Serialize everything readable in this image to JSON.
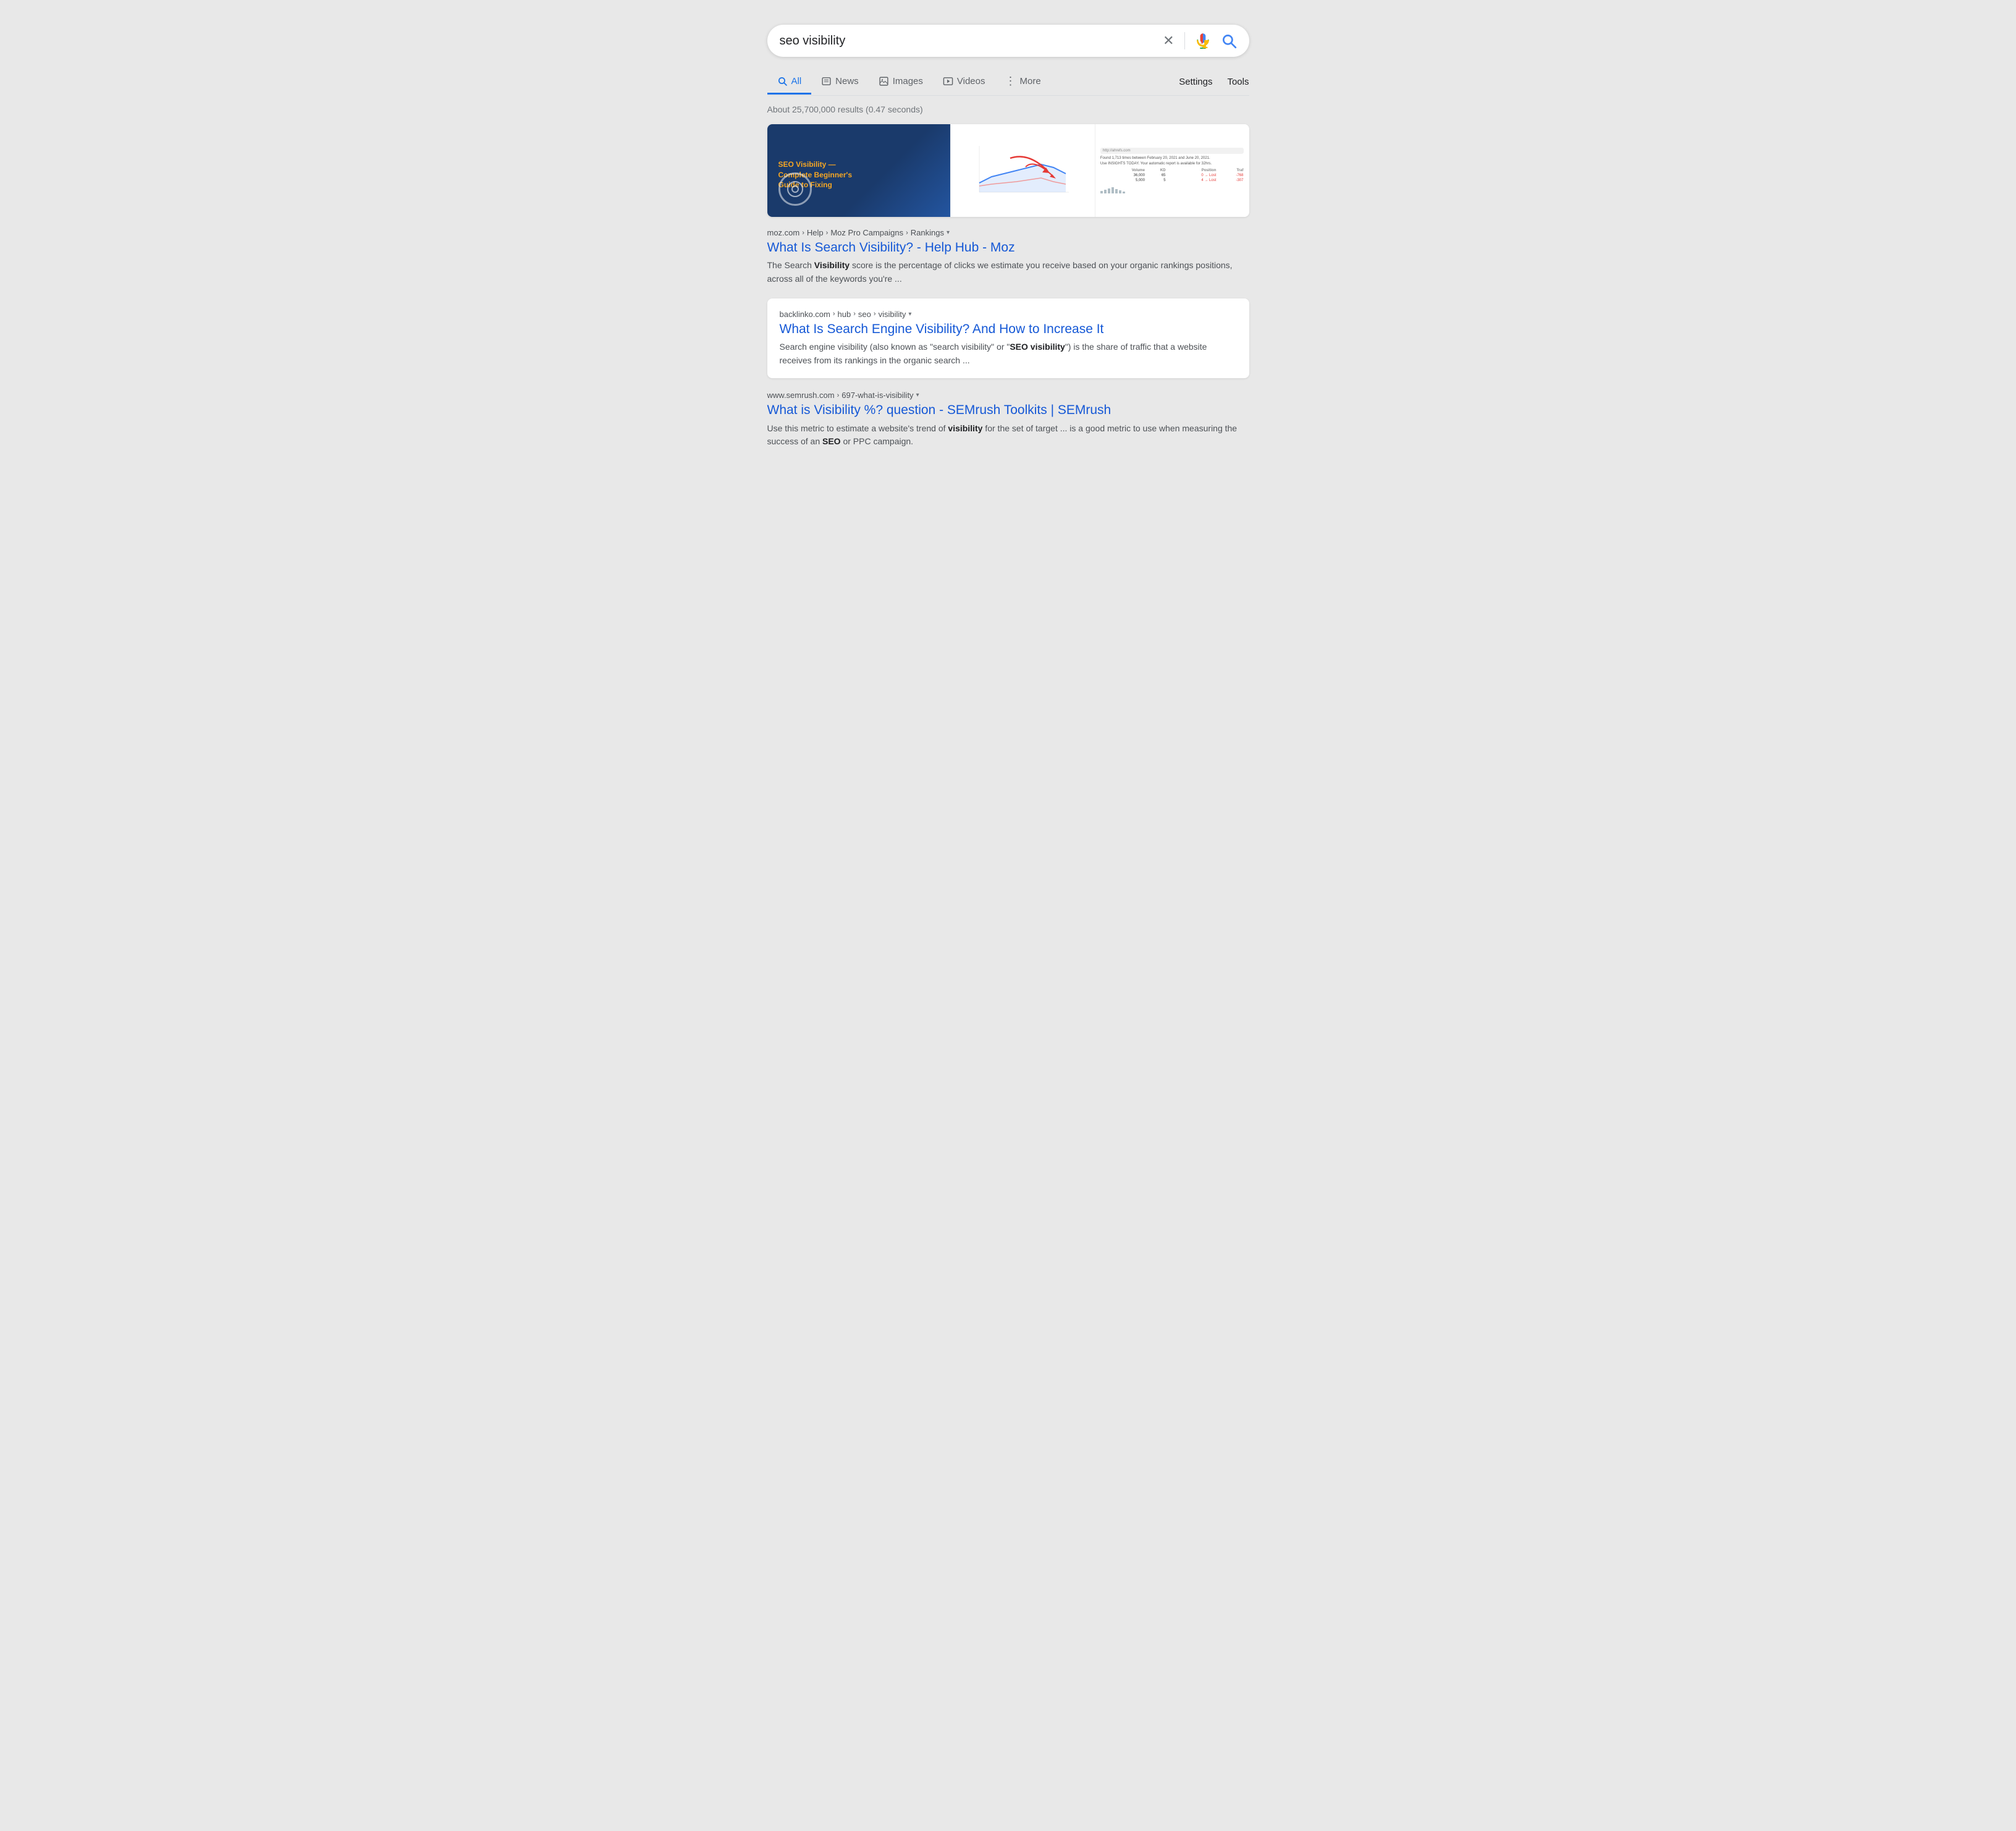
{
  "searchbar": {
    "query": "seo visibility",
    "placeholder": "seo visibility"
  },
  "nav": {
    "tabs": [
      {
        "id": "all",
        "label": "All",
        "icon": "search",
        "active": true
      },
      {
        "id": "news",
        "label": "News",
        "icon": "news",
        "active": false
      },
      {
        "id": "images",
        "label": "Images",
        "icon": "images",
        "active": false
      },
      {
        "id": "videos",
        "label": "Videos",
        "icon": "videos",
        "active": false
      },
      {
        "id": "more",
        "label": "More",
        "icon": "more",
        "active": false
      }
    ],
    "right_items": [
      "Settings",
      "Tools"
    ]
  },
  "results_count": "About 25,700,000 results (0.47 seconds)",
  "results": [
    {
      "id": "moz",
      "breadcrumb": [
        "moz.com",
        "Help",
        "Moz Pro Campaigns",
        "Rankings"
      ],
      "title": "What Is Search Visibility? - Help Hub - Moz",
      "snippet_parts": [
        {
          "text": "The Search "
        },
        {
          "text": "Visibility",
          "bold": true
        },
        {
          "text": " score is the percentage of clicks we estimate you receive based on your organic rankings positions, across all of the keywords you're ..."
        }
      ],
      "highlighted": false
    },
    {
      "id": "backlinko",
      "breadcrumb": [
        "backlinko.com",
        "hub",
        "seo",
        "visibility"
      ],
      "title": "What Is Search Engine Visibility? And How to Increase It",
      "snippet_parts": [
        {
          "text": "Search engine visibility (also known as “search visibility” or “"
        },
        {
          "text": "SEO visibility",
          "bold": true
        },
        {
          "text": "”) is the share of traffic that a website receives from its rankings in the organic search ..."
        }
      ],
      "highlighted": true
    },
    {
      "id": "semrush",
      "breadcrumb": [
        "www.semrush.com",
        "697-what-is-visibility"
      ],
      "title": "What is Visibility %? question - SEMrush Toolkits | SEMrush",
      "snippet_parts": [
        {
          "text": "Use this metric to estimate a website's trend of "
        },
        {
          "text": "visibility",
          "bold": true
        },
        {
          "text": " for the set of target ... is a good metric to use when measuring the success of an "
        },
        {
          "text": "SEO",
          "bold": true
        },
        {
          "text": " or PPC campaign."
        }
      ],
      "highlighted": false
    }
  ],
  "featured_card": {
    "title_line1": "SEO Visibility —",
    "title_line2": "Complete Beginner's",
    "title_line3": "Guide to Fixing"
  },
  "icons": {
    "clear": "✕",
    "dots": "⋮",
    "dropdown": "▾"
  }
}
